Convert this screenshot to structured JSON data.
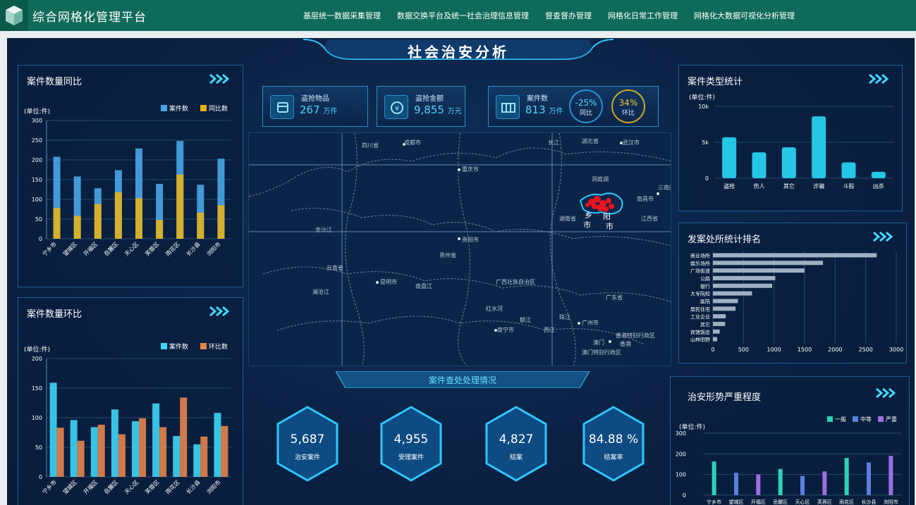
{
  "header": {
    "app_title": "综合网格化管理平台",
    "nav": [
      "基层统一数据采集管理",
      "数据交换平台及统一社会治理信息管理",
      "督查督办管理",
      "网格化日常工作管理",
      "网格化大数据可视化分析管理"
    ]
  },
  "page_title": "社会治安分析",
  "stats": {
    "stolen_items": {
      "label": "盗抢物品",
      "value": "267",
      "unit": "万件"
    },
    "stolen_amount": {
      "label": "盗抢金额",
      "value": "9,855",
      "unit": "万元"
    },
    "case_count": {
      "label": "案件数",
      "value": "813",
      "unit": "万件",
      "yoy": {
        "value": "-25%",
        "label": "同比"
      },
      "mom": {
        "value": "34%",
        "label": "环比"
      }
    }
  },
  "map": {
    "labels": [
      "四川省",
      "成都市",
      "重庆市",
      "湖北省",
      "武汉市",
      "长江",
      "南昌市",
      "江西省",
      "湖南省",
      "贵阳市",
      "贵州省",
      "金沙江",
      "云南省",
      "昆明市",
      "广西壮族自治区",
      "红水河",
      "南宁市",
      "郁江",
      "广州市",
      "广东省",
      "香港特别行政区",
      "澳门",
      "香港",
      "澳门特别行政区",
      "珠江",
      "乡",
      "阳",
      "市",
      "市",
      "澜沧江",
      "南盘江",
      "西江",
      "洞庭湖",
      "三南门"
    ],
    "hotspot_color": "#e8141e",
    "outline_color": "#2ec7ff"
  },
  "left_top": {
    "title": "案件数量同比",
    "chart_data": {
      "type": "bar",
      "unit_label": "(单位:件)",
      "categories": [
        "宁乡市",
        "望城区",
        "开福区",
        "岳麓区",
        "天心区",
        "芙蓉区",
        "雨花区",
        "长沙县",
        "浏阳市"
      ],
      "series": [
        {
          "name": "案件数",
          "values": [
            208,
            158,
            128,
            174,
            229,
            139,
            248,
            137,
            203
          ],
          "color": "#4aa6e6"
        },
        {
          "name": "同比数",
          "values": [
            78,
            58,
            88,
            118,
            103,
            48,
            163,
            66,
            85
          ],
          "color": "#e6b21a"
        }
      ],
      "ylim": [
        0,
        300
      ],
      "yticks": [
        0,
        50,
        100,
        150,
        200,
        250,
        300
      ],
      "legend": "top-right",
      "grid": true
    }
  },
  "left_bottom": {
    "title": "案件数量环比",
    "chart_data": {
      "type": "bar",
      "unit_label": "(单位:件)",
      "categories": [
        "宁乡市",
        "望城区",
        "开福区",
        "岳麓区",
        "天心区",
        "芙蓉区",
        "雨花区",
        "长沙县",
        "浏阳市"
      ],
      "series": [
        {
          "name": "案件数",
          "values": [
            159,
            96,
            84,
            114,
            94,
            124,
            69,
            55,
            108
          ],
          "color": "#3ed5f5"
        },
        {
          "name": "环比数",
          "values": [
            83,
            61,
            88,
            72,
            99,
            84,
            134,
            68,
            86
          ],
          "color": "#e8834a"
        }
      ],
      "ylim": [
        0,
        200
      ],
      "yticks": [
        0,
        50,
        100,
        150,
        200
      ],
      "legend": "top-right",
      "grid": true
    }
  },
  "right_top": {
    "title": "案件类型统计",
    "chart_data": {
      "type": "bar",
      "unit_label": "(单位:件)",
      "categories": [
        "盗抢",
        "伤人",
        "其它",
        "诈骗",
        "斗殴",
        "凶杀"
      ],
      "values": [
        5700,
        3600,
        4300,
        8600,
        2200,
        900
      ],
      "ylim": [
        0,
        10000
      ],
      "yticks": [
        "0",
        "5k",
        "10k"
      ],
      "color": "#26c6e6",
      "grid": true
    }
  },
  "right_mid": {
    "title": "发案处所统计排名",
    "chart_data": {
      "type": "bar",
      "orientation": "horizontal",
      "categories": [
        "商业场所",
        "娱乐场所",
        "广场街道",
        "公路",
        "银行",
        "大专院校",
        "医院",
        "居民住宅",
        "工业企业",
        "其它",
        "宾馆饭店",
        "山林田野"
      ],
      "values": [
        2680,
        1800,
        1500,
        1020,
        970,
        640,
        410,
        370,
        210,
        200,
        110,
        70
      ],
      "xlim": [
        0,
        3000
      ],
      "xticks": [
        0,
        500,
        1000,
        1500,
        2000,
        2500,
        3000
      ],
      "color": "#9fb0c2",
      "grid": true
    }
  },
  "right_bottom": {
    "title": "治安形势严重程度",
    "chart_data": {
      "type": "bar",
      "unit_label": "(单位:件)",
      "categories": [
        "宁乡市",
        "望城区",
        "开福区",
        "岳麓区",
        "天心区",
        "芙蓉区",
        "雨花区",
        "长沙县",
        "浏阳市"
      ],
      "series": [
        {
          "name": "一般",
          "color": "#2bd1b8"
        },
        {
          "name": "中等",
          "color": "#5b7fdc"
        },
        {
          "name": "严重",
          "color": "#9b6fe0"
        }
      ],
      "values": [
        163,
        108,
        100,
        127,
        93,
        115,
        180,
        158,
        190
      ],
      "value_series": [
        0,
        1,
        2,
        0,
        1,
        2,
        0,
        1,
        2
      ],
      "ylim": [
        0,
        300
      ],
      "yticks": [
        0,
        100,
        200,
        300
      ],
      "legend": "top-right",
      "grid": true
    }
  },
  "handling": {
    "title": "案件查处处理情况",
    "items": [
      {
        "value": "5,687",
        "label": "治安案件"
      },
      {
        "value": "4,955",
        "label": "受理案件"
      },
      {
        "value": "4,827",
        "label": "结案"
      },
      {
        "value": "84.88 %",
        "label": "结案率"
      }
    ]
  }
}
